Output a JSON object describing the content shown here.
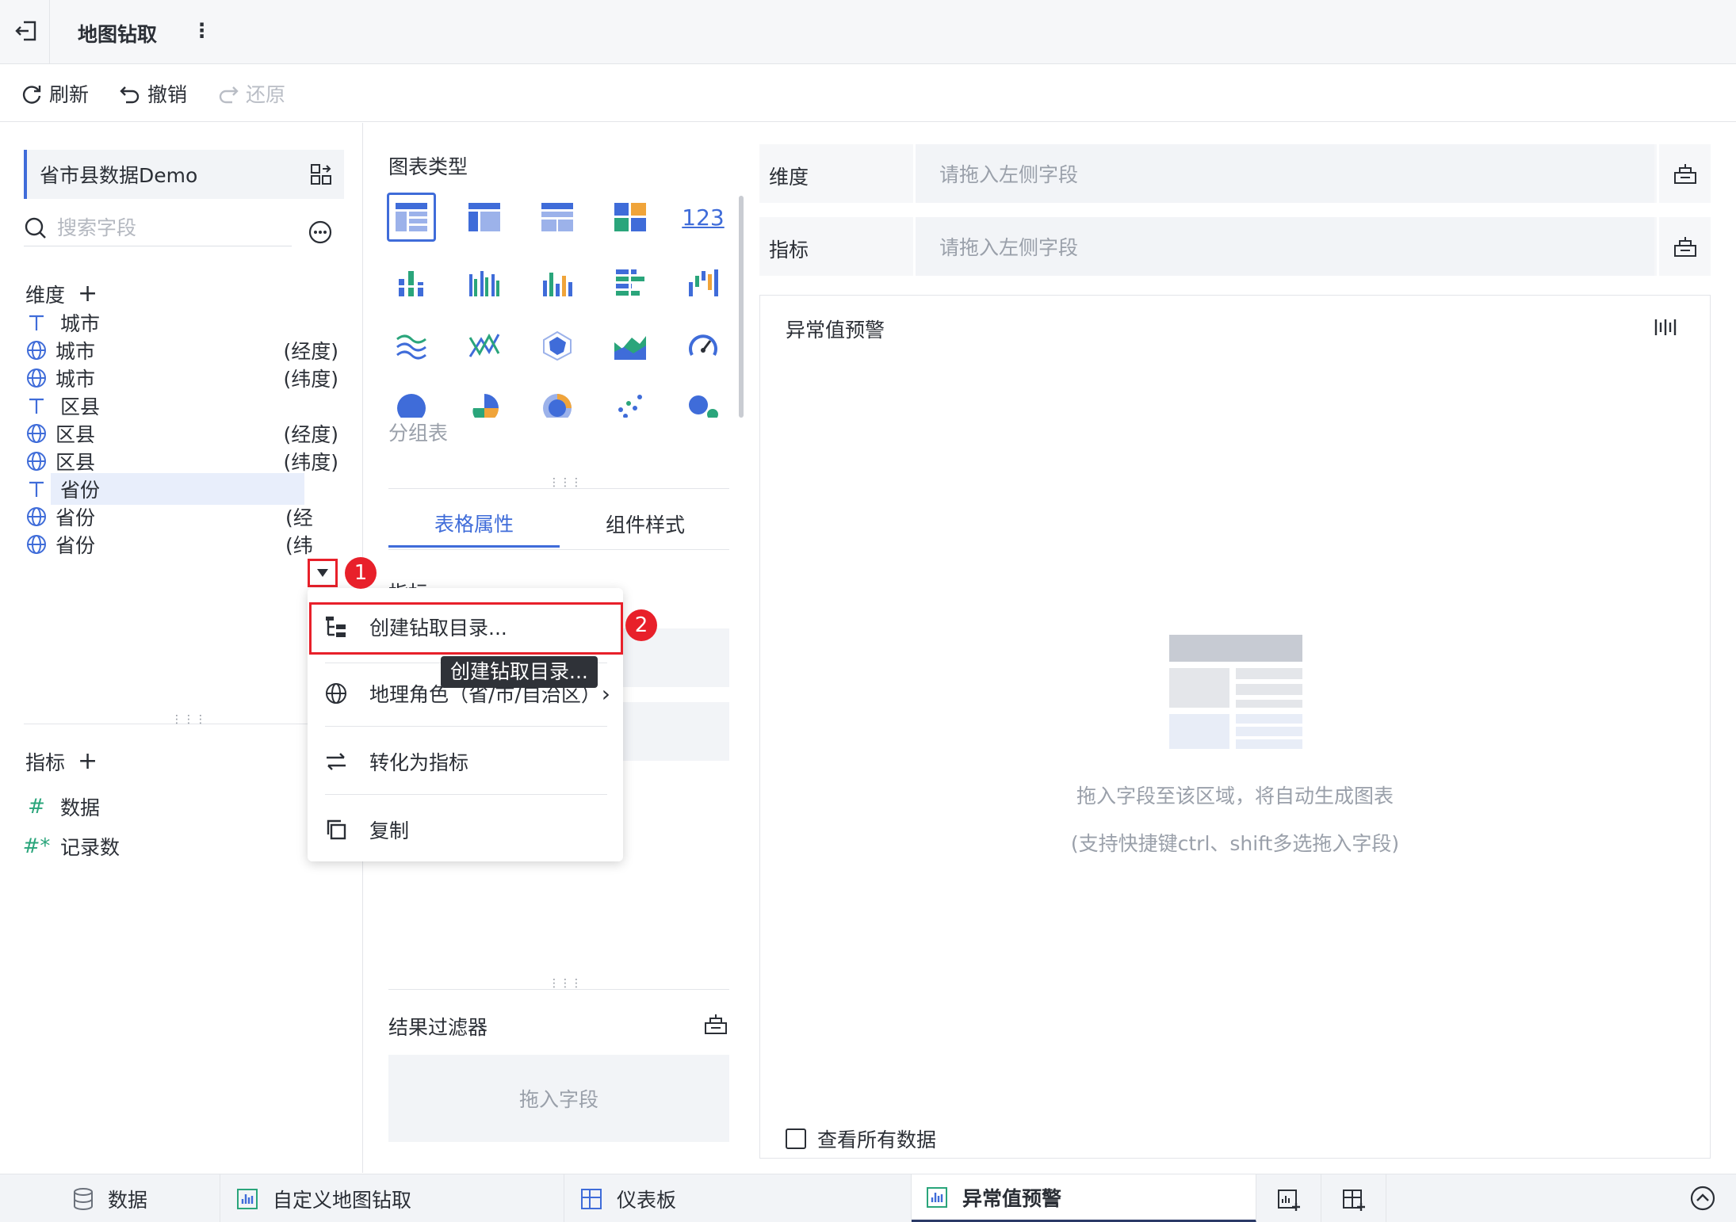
{
  "header": {
    "title": "地图钻取"
  },
  "toolbar": {
    "refresh": "刷新",
    "undo": "撤销",
    "redo": "还原"
  },
  "left": {
    "dataset": "省市县数据Demo",
    "search_placeholder": "搜索字段",
    "dimensions_title": "维度",
    "dimensions": [
      {
        "type": "text",
        "name": "城市",
        "suffix": ""
      },
      {
        "type": "geo",
        "name": "城市",
        "suffix": "(经度)"
      },
      {
        "type": "geo",
        "name": "城市",
        "suffix": "(纬度)"
      },
      {
        "type": "text",
        "name": "区县",
        "suffix": ""
      },
      {
        "type": "geo",
        "name": "区县",
        "suffix": "(经度)"
      },
      {
        "type": "geo",
        "name": "区县",
        "suffix": "(纬度)"
      },
      {
        "type": "text",
        "name": "省份",
        "suffix": ""
      },
      {
        "type": "geo",
        "name": "省份",
        "suffix": "(经"
      },
      {
        "type": "geo",
        "name": "省份",
        "suffix": "(纬"
      }
    ],
    "measures_title": "指标",
    "measures": [
      {
        "name": "数据"
      },
      {
        "name": "记录数"
      }
    ]
  },
  "middle": {
    "chart_type_title": "图表类型",
    "chart_type_selected_label": "分组表",
    "tabs": [
      "表格属性",
      "组件样式"
    ],
    "partial_label": "指标",
    "result_filter_title": "结果过滤器",
    "result_filter_hint": "拖入字段"
  },
  "right": {
    "dimension_label": "维度",
    "dimension_hint": "请拖入左侧字段",
    "measure_label": "指标",
    "measure_hint": "请拖入左侧字段",
    "component_title": "异常值预警",
    "empty_hint_1": "拖入字段至该区域，将自动生成图表",
    "empty_hint_2": "(支持快捷键ctrl、shift多选拖入字段)",
    "view_all_label": "查看所有数据"
  },
  "context_menu": {
    "items": [
      "创建钻取目录...",
      "地理角色（省/市/自治区）",
      "转化为指标",
      "复制"
    ],
    "tooltip": "创建钻取目录..."
  },
  "badges": [
    "1",
    "2"
  ],
  "bottom_tabs": [
    "数据",
    "自定义地图钻取",
    "仪表板",
    "异常值预警"
  ],
  "colors": {
    "accent": "#3f6cd9",
    "highlight": "#e8202a"
  }
}
